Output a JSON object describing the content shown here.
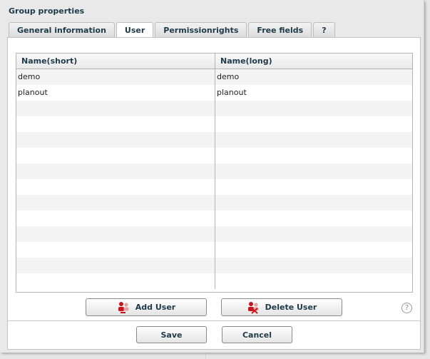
{
  "dialog": {
    "title": "Group properties"
  },
  "tabs": [
    {
      "label": "General information",
      "active": false
    },
    {
      "label": "User",
      "active": true
    },
    {
      "label": "Permissionrights",
      "active": false
    },
    {
      "label": "Free fields",
      "active": false
    },
    {
      "label": "?",
      "active": false
    }
  ],
  "table": {
    "columns": [
      "Name(short)",
      "Name(long)"
    ],
    "rows": [
      [
        "demo",
        "demo"
      ],
      [
        "planout",
        "planout"
      ],
      [
        "",
        ""
      ],
      [
        "",
        ""
      ],
      [
        "",
        ""
      ],
      [
        "",
        ""
      ],
      [
        "",
        ""
      ],
      [
        "",
        ""
      ],
      [
        "",
        ""
      ],
      [
        "",
        ""
      ],
      [
        "",
        ""
      ],
      [
        "",
        ""
      ],
      [
        "",
        ""
      ],
      [
        "",
        ""
      ]
    ]
  },
  "actions": {
    "add_user": "Add User",
    "delete_user": "Delete User",
    "help": "?"
  },
  "footer": {
    "save": "Save",
    "cancel": "Cancel"
  }
}
